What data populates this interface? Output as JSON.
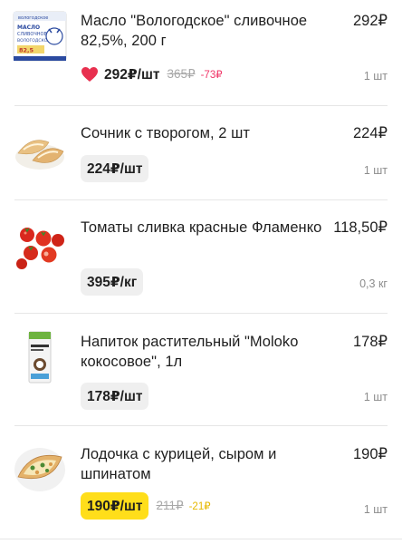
{
  "colors": {
    "accent_red": "#f0386a",
    "promo_yellow": "#ffde1a",
    "badge_gray": "#efefef"
  },
  "cart_items": [
    {
      "image": "butter-pack-image",
      "title": "Масло \"Вологодское\" сливочное 82,5%, 200 г",
      "price": "292₽",
      "unit_price": "292₽/шт",
      "old_price": "365₽",
      "discount": "-73₽",
      "quantity": "1 шт",
      "icon": "heart-icon"
    },
    {
      "image": "sochnik-image",
      "title": "Сочник с творогом, 2 шт",
      "price": "224₽",
      "unit_price": "224₽/шт",
      "quantity": "1 шт"
    },
    {
      "image": "tomatoes-image",
      "title": "Томаты сливка красные Фламенко",
      "price": "118,50₽",
      "unit_price": "395₽/кг",
      "quantity": "0,3 кг"
    },
    {
      "image": "coconut-milk-image",
      "title": "Напиток растительный \"Moloko кокосовое\", 1л",
      "price": "178₽",
      "unit_price": "178₽/шт",
      "quantity": "1 шт"
    },
    {
      "image": "chicken-boat-image",
      "title": "Лодочка с курицей, сыром и шпинатом",
      "price": "190₽",
      "unit_price": "190₽/шт",
      "old_price": "211₽",
      "discount": "-21₽",
      "quantity": "1 шт"
    }
  ]
}
